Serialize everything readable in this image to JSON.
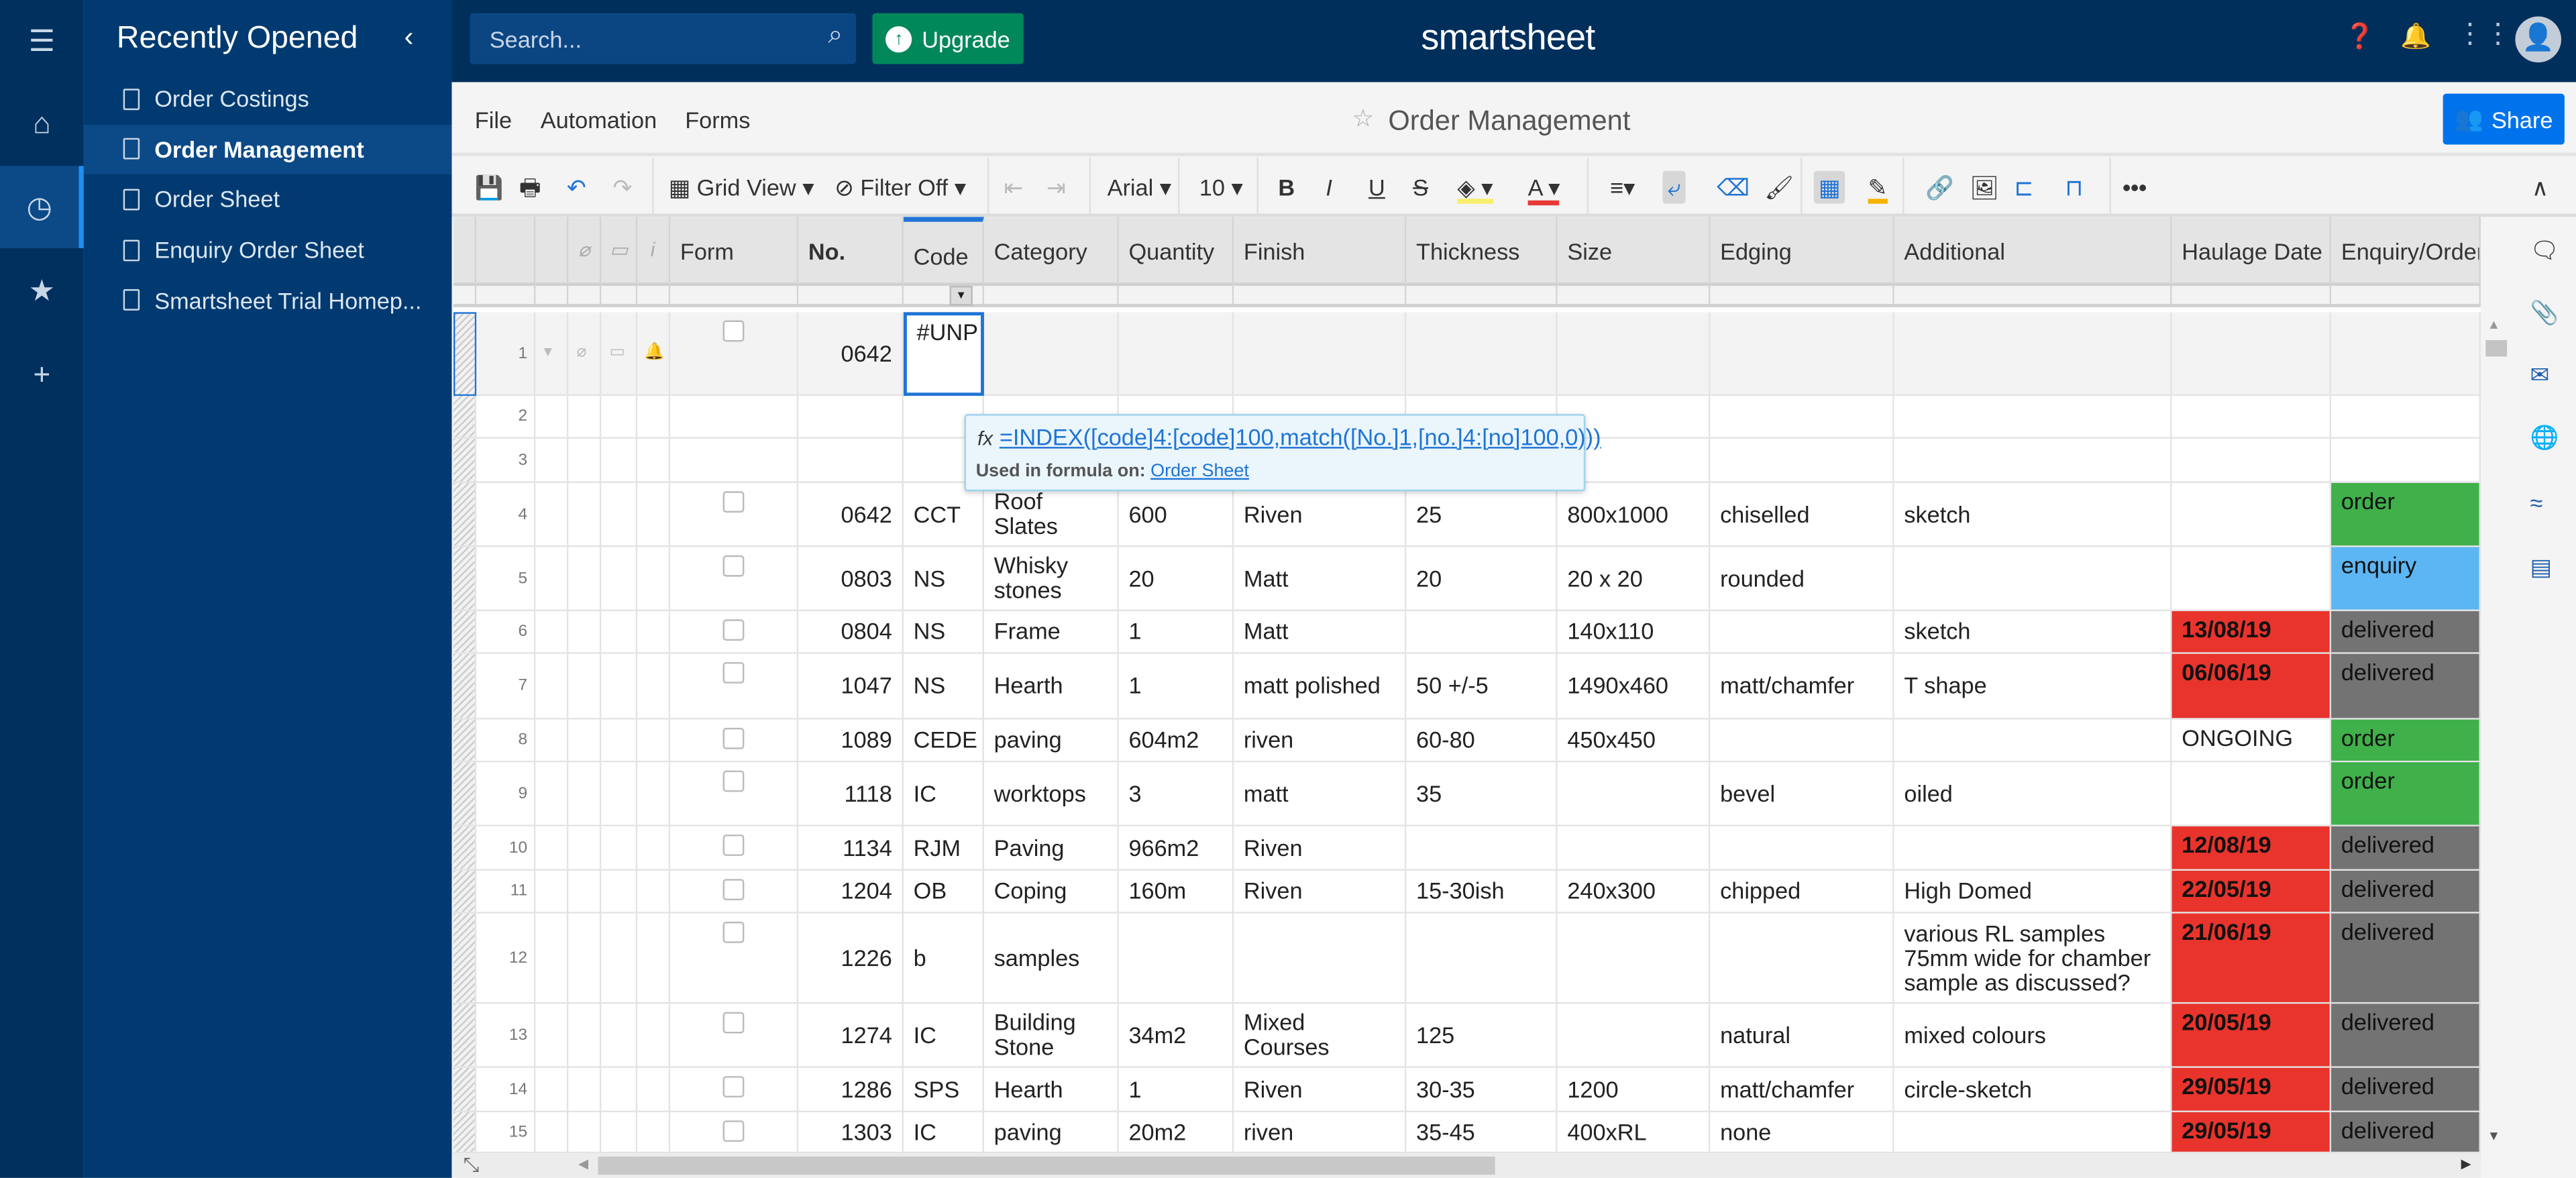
{
  "rail": {
    "items": [
      {
        "icon": "menu-icon",
        "glyph": "☰"
      },
      {
        "icon": "home-icon",
        "glyph": "⌂"
      },
      {
        "icon": "clock-icon",
        "glyph": "◷",
        "selected": true
      },
      {
        "icon": "star-icon",
        "glyph": "★"
      },
      {
        "icon": "plus-icon",
        "glyph": "+"
      }
    ]
  },
  "sidebar": {
    "title": "Recently Opened",
    "collapse": "‹",
    "items": [
      {
        "label": "Order Costings"
      },
      {
        "label": "Order Management",
        "selected": true
      },
      {
        "label": "Order Sheet"
      },
      {
        "label": "Enquiry Order Sheet"
      },
      {
        "label": "Smartsheet Trial Homep..."
      }
    ]
  },
  "topbar": {
    "search_placeholder": "Search...",
    "upgrade": "Upgrade",
    "logo": "smartsheet",
    "icons": [
      "help-icon",
      "bell-icon",
      "apps-grid-icon",
      "avatar-icon"
    ]
  },
  "menubar": {
    "items": [
      "File",
      "Automation",
      "Forms"
    ],
    "sheet_title": "Order Management",
    "share": "Share"
  },
  "toolbar": {
    "view": "Grid View",
    "filter": "Filter Off",
    "font": "Arial",
    "size": "10",
    "colors": {
      "highlight": "#f7ef6a",
      "text": "#e53935",
      "accent": "#1f74d6"
    }
  },
  "grid": {
    "headers": [
      "Form",
      "No.",
      "Code",
      "Category",
      "Quantity",
      "Finish",
      "Thickness",
      "Size",
      "Edging",
      "Additional",
      "Haulage Date",
      "Enquiry/Order"
    ],
    "colors": {
      "red": "#e8342c",
      "order": "#3fb04a",
      "enquiry": "#5db6f4",
      "delivered": "#737373"
    },
    "rows": [
      {
        "n": "1",
        "chk": true,
        "c": [
          "0642",
          "#UNP",
          "",
          "",
          "",
          "",
          "",
          "",
          "",
          "",
          "",
          ""
        ]
      },
      {
        "n": "2",
        "chk": false,
        "c": [
          "",
          "",
          "",
          "",
          "",
          "",
          "",
          "",
          "",
          "",
          "",
          ""
        ]
      },
      {
        "n": "3",
        "chk": false,
        "c": [
          "",
          "",
          "",
          "",
          "",
          "",
          "",
          "",
          "",
          "",
          "",
          ""
        ]
      },
      {
        "n": "4",
        "chk": true,
        "c": [
          "0642",
          "CCT",
          "Roof Slates",
          "600",
          "Riven",
          "25",
          "800x1000",
          "chiselled",
          "sketch",
          "",
          "order"
        ],
        "e": "order"
      },
      {
        "n": "5",
        "chk": true,
        "c": [
          "0803",
          "NS",
          "Whisky stones",
          "20",
          "Matt",
          "20",
          "20 x 20",
          "rounded",
          "",
          "",
          "enquiry"
        ],
        "e": "enquiry"
      },
      {
        "n": "6",
        "chk": true,
        "c": [
          "0804",
          "NS",
          "Frame",
          "1",
          "Matt",
          "",
          "140x110",
          "",
          "sketch",
          "13/08/19",
          "delivered"
        ],
        "h": "red",
        "e": "delivered"
      },
      {
        "n": "7",
        "chk": true,
        "c": [
          "1047",
          "NS",
          "Hearth",
          "1",
          "matt polished",
          "50 +/-5",
          "1490x460",
          "matt/chamfer",
          "T shape",
          "06/06/19",
          "delivered"
        ],
        "h": "red",
        "e": "delivered"
      },
      {
        "n": "8",
        "chk": true,
        "c": [
          "1089",
          "CEDE",
          "paving",
          "604m2",
          "riven",
          "60-80",
          "450x450",
          "",
          "",
          "ONGOING",
          "order"
        ],
        "e": "order"
      },
      {
        "n": "9",
        "chk": true,
        "c": [
          "1118",
          "IC",
          "worktops",
          "3",
          "matt",
          "35",
          "",
          "bevel",
          "oiled",
          "",
          "order"
        ],
        "e": "order"
      },
      {
        "n": "10",
        "chk": true,
        "c": [
          "1134",
          "RJM",
          "Paving",
          "966m2",
          "Riven",
          "",
          "",
          "",
          "",
          "12/08/19",
          "delivered"
        ],
        "h": "red",
        "e": "delivered"
      },
      {
        "n": "11",
        "chk": true,
        "c": [
          "1204",
          "OB",
          "Coping",
          "160m",
          "Riven",
          "15-30ish",
          "240x300",
          "chipped",
          "High Domed",
          "22/05/19",
          "delivered"
        ],
        "h": "red",
        "e": "delivered"
      },
      {
        "n": "12",
        "chk": true,
        "c": [
          "1226",
          "b",
          "samples",
          "",
          "",
          "",
          "",
          "",
          "various RL samples 75mm wide for chamber sample as discussed?",
          "21/06/19",
          "delivered"
        ],
        "h": "red",
        "e": "delivered"
      },
      {
        "n": "13",
        "chk": true,
        "c": [
          "1274",
          "IC",
          "Building Stone",
          "34m2",
          "Mixed Courses",
          "125",
          "",
          "natural",
          "mixed colours",
          "20/05/19",
          "delivered"
        ],
        "h": "red",
        "e": "delivered"
      },
      {
        "n": "14",
        "chk": true,
        "c": [
          "1286",
          "SPS",
          "Hearth",
          "1",
          "Riven",
          "30-35",
          "1200",
          "matt/chamfer",
          "circle-sketch",
          "29/05/19",
          "delivered"
        ],
        "h": "red",
        "e": "delivered"
      },
      {
        "n": "15",
        "chk": true,
        "c": [
          "1303",
          "IC",
          "paving",
          "20m2",
          "riven",
          "35-45",
          "400xRL",
          "none",
          "",
          "29/05/19",
          "delivered"
        ],
        "h": "red",
        "e": "delivered"
      }
    ]
  },
  "tooltip": {
    "formula": "=INDEX([code]4:[code]100,match([No.]1,[no.]4:[no]100,0)))",
    "used_label": "Used in formula on:",
    "used_link": "Order Sheet"
  }
}
